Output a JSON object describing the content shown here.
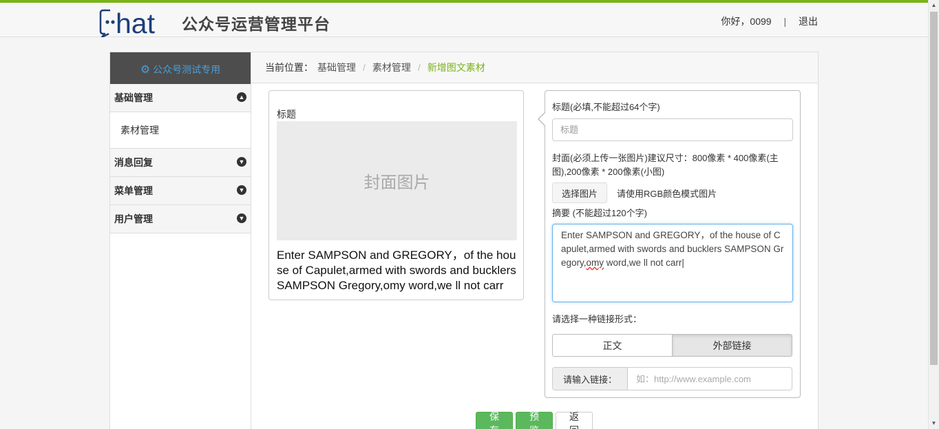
{
  "header": {
    "logo_text": "hat",
    "site_title": "公众号运营管理平台",
    "greeting": "你好，0099",
    "separator": "|",
    "logout": "退出"
  },
  "sidebar": {
    "account_name": "公众号测试专用",
    "groups": [
      {
        "label": "基础管理",
        "expanded": true,
        "icon": "arrow-up-circle-icon",
        "children": [
          "素材管理"
        ]
      },
      {
        "label": "消息回复",
        "expanded": false,
        "icon": "arrow-down-circle-icon"
      },
      {
        "label": "菜单管理",
        "expanded": false,
        "icon": "arrow-down-circle-icon"
      },
      {
        "label": "用户管理",
        "expanded": false,
        "icon": "arrow-down-circle-icon"
      }
    ]
  },
  "breadcrumb": {
    "label": "当前位置：",
    "items": [
      "基础管理",
      "素材管理"
    ],
    "current": "新增图文素材"
  },
  "preview": {
    "title": "标题",
    "cover_placeholder": "封面图片",
    "summary": "Enter SAMPSON and GREGORY，of the house of Capulet,armed with swords and bucklers SAMPSON Gregory,omy word,we ll not carr"
  },
  "editor": {
    "title_label": "标题(必填,不能超过64个字)",
    "title_placeholder": "标题",
    "cover_label": "封面(必须上传一张图片)建议尺寸：800像素 * 400像素(主图),200像素 * 200像素(小图)",
    "choose_image": "选择图片",
    "rgb_hint": "请使用RGB颜色模式图片",
    "summary_label": "摘要 (不能超过120个字)",
    "summary_value_a": "Enter SAMPSON and GREGORY，of the house of  Capulet,armed with swords and bucklers SAMPSON Gregory,",
    "summary_value_misspelled": "omy",
    "summary_value_b": " word,we ll not carr",
    "link_label": "请选择一种链接形式：",
    "link_options": [
      "正文",
      "外部链接"
    ],
    "link_selected": "外部链接",
    "url_addon": "请输入链接：",
    "url_placeholder": "如：http://www.example.com"
  },
  "actions": {
    "save": "保存",
    "preview": "预览",
    "back": "返回"
  },
  "colors": {
    "brand_green": "#7ab317",
    "logo_blue": "#1d3e7a",
    "button_green": "#5cb85c",
    "sidebar_head_bg": "#4d4d4d",
    "sidebar_head_text": "#4a9ed8"
  }
}
